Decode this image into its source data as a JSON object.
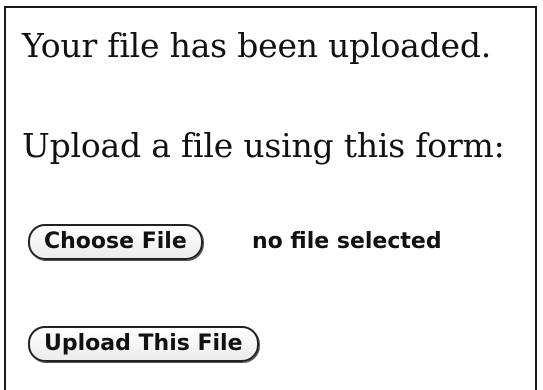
{
  "messages": {
    "uploaded": "Your file has been uploaded.",
    "prompt": "Upload a file using this form:"
  },
  "form": {
    "choose_button_label": "Choose File",
    "file_status": "no file selected",
    "upload_button_label": "Upload This File"
  }
}
